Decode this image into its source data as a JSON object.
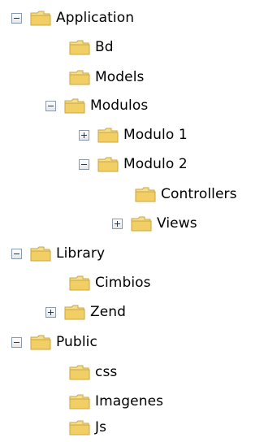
{
  "tree": {
    "rows": [
      {
        "label": "Application",
        "toggle": "minus"
      },
      {
        "label": "Bd",
        "toggle": "none"
      },
      {
        "label": "Models",
        "toggle": "none"
      },
      {
        "label": "Modulos",
        "toggle": "minus"
      },
      {
        "label": "Modulo 1",
        "toggle": "plus"
      },
      {
        "label": "Modulo 2",
        "toggle": "minus"
      },
      {
        "label": "Controllers",
        "toggle": "none"
      },
      {
        "label": "Views",
        "toggle": "plus"
      },
      {
        "label": "Library",
        "toggle": "minus"
      },
      {
        "label": "Cimbios",
        "toggle": "none"
      },
      {
        "label": "Zend",
        "toggle": "plus"
      },
      {
        "label": "Public",
        "toggle": "minus"
      },
      {
        "label": "css",
        "toggle": "none"
      },
      {
        "label": "Imagenes",
        "toggle": "none"
      },
      {
        "label": "Js",
        "toggle": "none"
      }
    ]
  },
  "icons": {
    "toggle": "expand-collapse-icon",
    "folder": "folder-icon"
  },
  "colors": {
    "folder_fill": "#f3d57a",
    "folder_stroke": "#c9a640",
    "toggle_border": "#8a9aac"
  }
}
